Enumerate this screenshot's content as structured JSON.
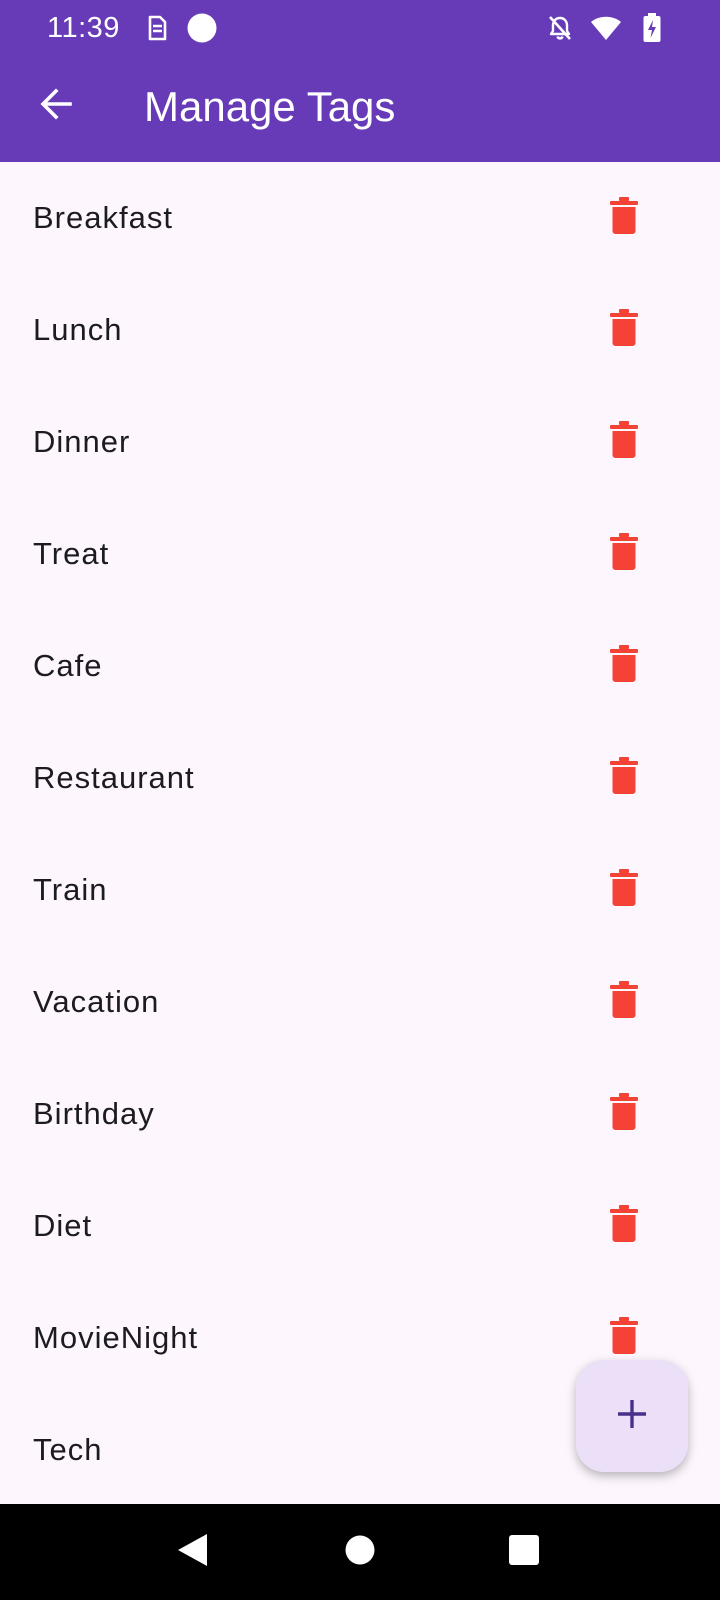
{
  "status_bar": {
    "time": "11:39",
    "left_icons": [
      "sim-card-icon",
      "record-dot-icon"
    ],
    "right_icons": [
      "notifications-off-icon",
      "wifi-icon",
      "battery-charging-icon"
    ]
  },
  "app_bar": {
    "title": "Manage Tags",
    "back_icon": "arrow-back-icon"
  },
  "tags": [
    {
      "label": "Breakfast"
    },
    {
      "label": "Lunch"
    },
    {
      "label": "Dinner"
    },
    {
      "label": "Treat"
    },
    {
      "label": "Cafe"
    },
    {
      "label": "Restaurant"
    },
    {
      "label": "Train"
    },
    {
      "label": "Vacation"
    },
    {
      "label": "Birthday"
    },
    {
      "label": "Diet"
    },
    {
      "label": "MovieNight"
    },
    {
      "label": "Tech"
    }
  ],
  "delete_icon": "trash-icon",
  "fab": {
    "icon": "add-icon"
  },
  "nav_bar": {
    "buttons": [
      "back-triangle-icon",
      "home-circle-icon",
      "recents-square-icon"
    ]
  },
  "colors": {
    "primary": "#673ab7",
    "background": "#fdf7fd",
    "delete": "#f44336",
    "fab_background": "#ece0f9",
    "fab_icon": "#4a2f8a",
    "text": "#1c1b1f"
  }
}
